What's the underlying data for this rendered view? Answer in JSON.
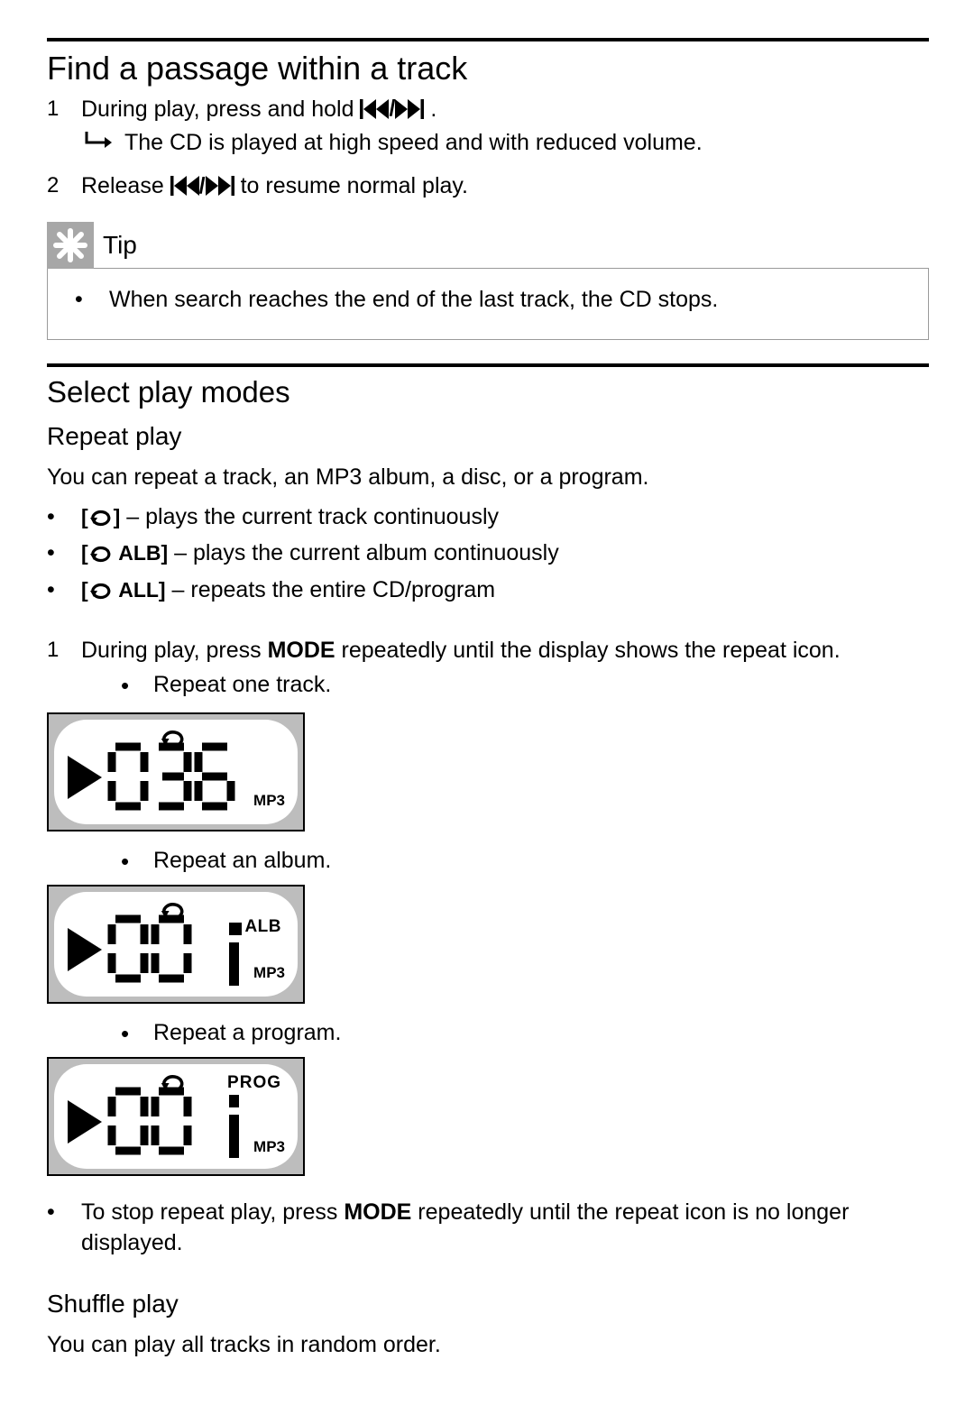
{
  "section1": {
    "title": "Find a passage within a track",
    "step1": {
      "num": "1",
      "text_before": "During play, press and hold ",
      "text_after": ".",
      "result": "The CD is played at high speed and with reduced volume."
    },
    "step2": {
      "num": "2",
      "text_before": "Release ",
      "text_after": " to resume normal play."
    }
  },
  "tip": {
    "label": "Tip",
    "bullet": "When search reaches the end of the last track, the CD stops."
  },
  "section2": {
    "title": "Select play modes",
    "sub1_title": "Repeat play",
    "intro": "You can repeat a track, an MP3 album, a disc, or a program.",
    "modes": {
      "a": {
        "prefix": "[",
        "suffix": "]",
        "desc": " – plays the current track continuously"
      },
      "b": {
        "prefix": "[",
        "label": " ALB",
        "suffix": "]",
        "desc": " – plays the current album continuously"
      },
      "c": {
        "prefix": "[",
        "label": " ALL",
        "suffix": "]",
        "desc": " – repeats the entire CD/program"
      }
    },
    "step1": {
      "num": "1",
      "t1": "During play, press ",
      "mode": "MODE",
      "t2": " repeatedly until the display shows the repeat icon.",
      "items": {
        "a": "Repeat one track.",
        "b": "Repeat an album.",
        "c": "Repeat a program."
      }
    },
    "lcd": {
      "mp3": "MP3",
      "alb": "ALB",
      "prog": "PROG",
      "d036": "036",
      "d00": "00",
      "d1": "1"
    },
    "stop": {
      "t1": "To stop repeat play, press ",
      "mode": "MODE",
      "t2": " repeatedly until the repeat icon is no longer displayed."
    },
    "sub2_title": "Shuffle play",
    "sub2_intro": "You can play all tracks in random order."
  }
}
